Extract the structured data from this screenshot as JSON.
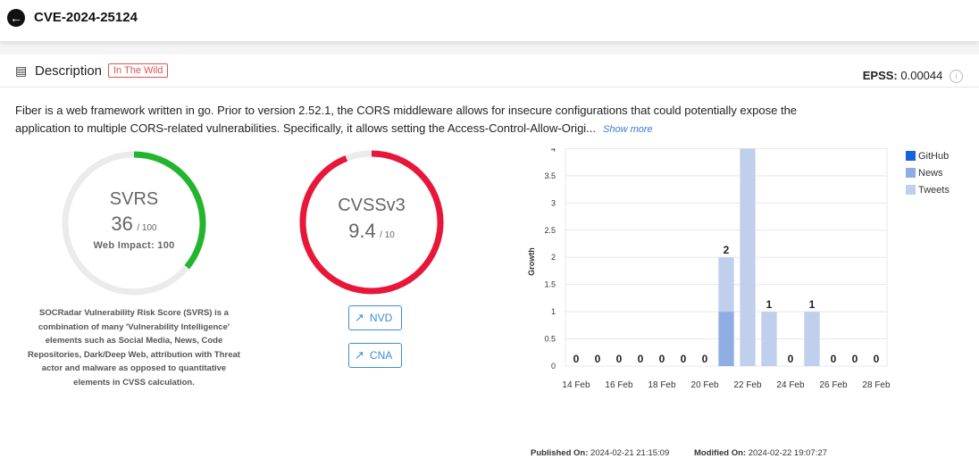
{
  "header": {
    "cve_id": "CVE-2024-25124"
  },
  "description": {
    "title": "Description",
    "badge": "In The Wild",
    "epss_label": "EPSS:",
    "epss_value": "0.00044",
    "line1": "Fiber is a web framework written in go. Prior to version 2.52.1, the CORS middleware allows for insecure configurations that could potentially expose the",
    "line2": "application to multiple CORS-related vulnerabilities. Specifically, it allows setting the Access-Control-Allow-Origi...",
    "show_more": "Show more"
  },
  "svrs": {
    "label": "SVRS",
    "score": "36",
    "max": "/ 100",
    "score_value": 36,
    "web_impact": "Web Impact: 100",
    "color": "#22b52e",
    "explanation": [
      "SOCRadar Vulnerability Risk Score (SVRS) is a",
      "combination of many 'Vulnerability Intelligence'",
      "elements such as Social Media, News, Code",
      "Repositories, Dark/Deep Web, attribution with Threat",
      "actor and malware as opposed to quantitative",
      "elements in CVSS calculation."
    ]
  },
  "cvss": {
    "label": "CVSSv3",
    "score": "9.4",
    "max": "/ 10",
    "score_value": 9.4,
    "color": "#e8173a"
  },
  "links": {
    "nvd": "NVD",
    "cna": "CNA"
  },
  "chart_data": {
    "type": "bar",
    "ylabel": "Growth",
    "ylim": [
      0,
      4.5
    ],
    "yticks": [
      "0",
      "0.5",
      "1",
      "1.5",
      "2",
      "2.5",
      "3",
      "3.5",
      "4",
      "4.5"
    ],
    "categories": [
      "14 Feb",
      "15 Feb",
      "16 Feb",
      "17 Feb",
      "18 Feb",
      "19 Feb",
      "20 Feb",
      "21 Feb",
      "22 Feb",
      "23 Feb",
      "24 Feb",
      "25 Feb",
      "26 Feb",
      "27 Feb",
      "28 Feb"
    ],
    "xtick_labels": [
      "14 Feb",
      "16 Feb",
      "18 Feb",
      "20 Feb",
      "22 Feb",
      "24 Feb",
      "26 Feb",
      "28 Feb"
    ],
    "series": [
      {
        "name": "GitHub",
        "color": "#1565d8",
        "values": [
          0,
          0,
          0,
          0,
          0,
          0,
          0,
          0,
          0,
          0,
          0,
          0,
          0,
          0,
          0
        ]
      },
      {
        "name": "News",
        "color": "#8eaee3",
        "values": [
          0,
          0,
          0,
          0,
          0,
          0,
          0,
          1,
          0,
          0,
          0,
          0,
          0,
          0,
          0
        ]
      },
      {
        "name": "Tweets",
        "color": "#bfcfec",
        "values": [
          0,
          0,
          0,
          0,
          0,
          0,
          0,
          1,
          4,
          1,
          0,
          1,
          0,
          0,
          0
        ]
      }
    ],
    "totals": [
      "0",
      "0",
      "0",
      "0",
      "0",
      "0",
      "0",
      "2",
      "4",
      "1",
      "0",
      "1",
      "0",
      "0",
      "0"
    ],
    "legend_position": "right",
    "grid": true
  },
  "footer": {
    "published_label": "Published On:",
    "published_value": "2024-02-21 21:15:09",
    "modified_label": "Modified On:",
    "modified_value": "2024-02-22 19:07:27"
  }
}
